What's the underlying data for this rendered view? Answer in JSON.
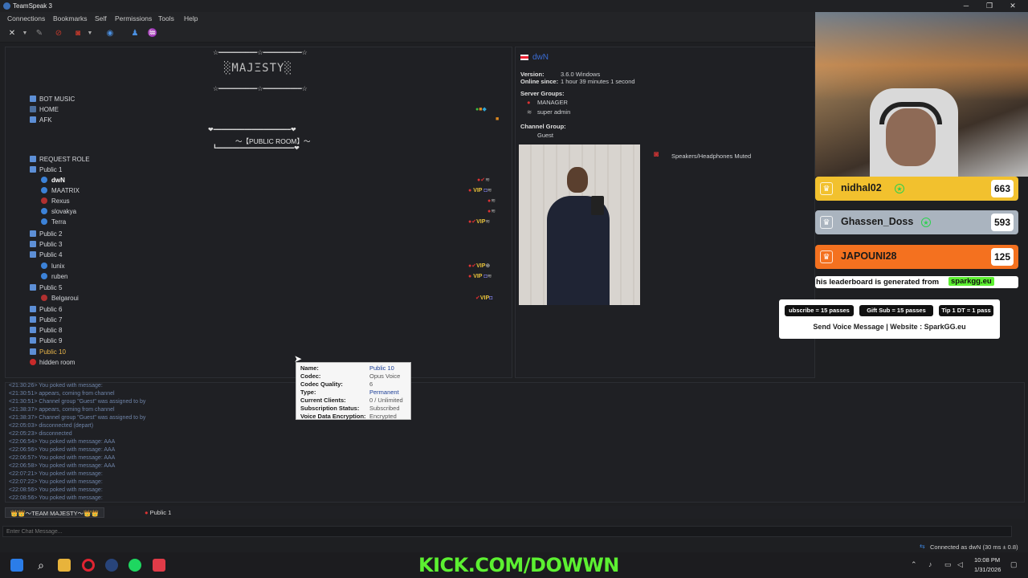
{
  "app_title": "TeamSpeak 3",
  "menu": [
    "Connections",
    "Bookmarks",
    "Self",
    "Permissions",
    "Tools",
    "Help"
  ],
  "tree": {
    "banner_stars": "☆━━━━━━━━━━☆━━━━━━━━━━☆",
    "banner_text": "░ΜΑJΞSΤΥ░",
    "public_room": "〜【PUBLIC ROOM】〜",
    "channels_top": [
      "BOT MUSIC",
      "HOME",
      "AFK"
    ],
    "request_role": "REQUEST ROLE",
    "public1": "Public 1",
    "public1_users": [
      "dwN",
      "MAATRIX",
      "Rexus",
      "slovakya",
      "Terra"
    ],
    "public2": "Public 2",
    "public3": "Public 3",
    "public4": "Public 4",
    "public4_users": [
      "lunix",
      "ruben"
    ],
    "public5": "Public 5",
    "public5_users": [
      "Belgaroui"
    ],
    "public_rest": [
      "Public 6",
      "Public 7",
      "Public 8",
      "Public 9",
      "Public 10"
    ],
    "hidden": "hidden room"
  },
  "info": {
    "username": "dwN",
    "version_label": "Version:",
    "version": "3.6.0 Windows",
    "online_label": "Online since:",
    "online": "1 hour 39 minutes 1 second",
    "server_groups_label": "Server Groups:",
    "server_groups": [
      "MANAGER",
      "super admin"
    ],
    "channel_group_label": "Channel Group:",
    "channel_group": "Guest",
    "muted": "Speakers/Headphones Muted"
  },
  "tooltip": {
    "keys": [
      "Name:",
      "Codec:",
      "Codec Quality:",
      "Type:",
      "Current Clients:",
      "Subscription Status:",
      "Voice Data Encryption:"
    ],
    "values": [
      "Public 10",
      "Opus Voice",
      "6",
      "Permanent",
      "0 / Unlimited",
      "Subscribed",
      "Encrypted"
    ]
  },
  "chatlog": [
    "<21:30:26> You poked with message:",
    "<21:30:51> appears, coming from channel",
    "<21:30:51> Channel group \"Guest\" was assigned to by",
    "<21:38:37> appears, coming from channel",
    "<21:38:37> Channel group \"Guest\" was assigned to by",
    "<22:05:03> disconnected (depart)",
    "<22:05:23> disconnected",
    "<22:06:54> You poked with message: AAA",
    "<22:06:56> You poked with message: AAA",
    "<22:06:57> You poked with message: AAA",
    "<22:06:58> You poked with message: AAA",
    "<22:07:21> You poked with message:",
    "<22:07:22> You poked with message:",
    "<22:08:56> You poked with message:",
    "<22:08:56> You poked with message:"
  ],
  "tabs": [
    "👑👑〜TEAM MAJESTY〜👑👑",
    "Public 1"
  ],
  "chat_placeholder": "Enter Chat Message...",
  "status": "Connected as dwN (30 ms ± 0.8)",
  "clock": {
    "time": "10:08 PM",
    "date": "1/31/2026"
  },
  "leaderboard": [
    {
      "name": "nidhal02",
      "score": "663",
      "color": "#f2c12e",
      "text": "#1a1a1a",
      "star": true
    },
    {
      "name": "Ghassen_Doss",
      "score": "593",
      "color": "#aab4bf",
      "text": "#1a1a1a",
      "star": true
    },
    {
      "name": "JAPOUNI28",
      "score": "125",
      "color": "#f4711f",
      "text": "#1a1a1a",
      "star": false
    }
  ],
  "lb_footer_pre": "his leaderboard is generated from",
  "lb_footer_site": "sparkgg.eu",
  "passes": [
    "ubscribe = 15 passes",
    "Gift Sub = 15 passes",
    "Tip 1 DT = 1 pass"
  ],
  "passes_footer": "Send Voice Message | Website : SparkGG.eu",
  "kick": "KICK.COM/DOWWN"
}
